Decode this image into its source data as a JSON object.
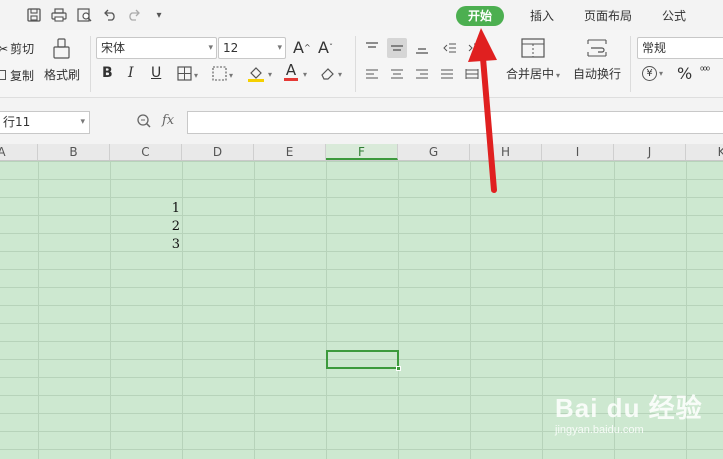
{
  "quick_access": {
    "icons": [
      "save-icon",
      "print-icon",
      "print-preview-icon",
      "undo-icon",
      "redo-icon",
      "customize-icon"
    ]
  },
  "tabs": {
    "home": "开始",
    "insert": "插入",
    "page_layout": "页面布局",
    "formulas": "公式"
  },
  "ribbon": {
    "cut": "剪切",
    "copy": "复制",
    "format_painter": "格式刷",
    "font_name": "宋体",
    "font_size": "12",
    "bold": "B",
    "italic": "I",
    "underline": "U",
    "merge_center": "合并居中",
    "wrap_text": "自动换行",
    "number_format": "常规",
    "percent": "%",
    "font_increase": "A",
    "font_decrease": "A",
    "font_color_letter": "A",
    "font_color": "#e53935",
    "fill_color": "#f5d000"
  },
  "formula_bar": {
    "name_box": "行11",
    "fx": "fx",
    "value": ""
  },
  "grid": {
    "columns": [
      "A",
      "B",
      "C",
      "D",
      "E",
      "F",
      "G",
      "H",
      "I",
      "J",
      "K"
    ],
    "selected_column": "F",
    "cells": [
      {
        "col": "C",
        "value": "1"
      },
      {
        "col": "C",
        "value": "2"
      },
      {
        "col": "C",
        "value": "3"
      }
    ],
    "sheet_color": "#cde8d0",
    "selection_color": "#3c9a3c"
  },
  "annotation": {
    "arrow_color": "#e02020"
  },
  "watermark": {
    "logo": "Bai du 经验",
    "url": "jingyan.baidu.com"
  }
}
